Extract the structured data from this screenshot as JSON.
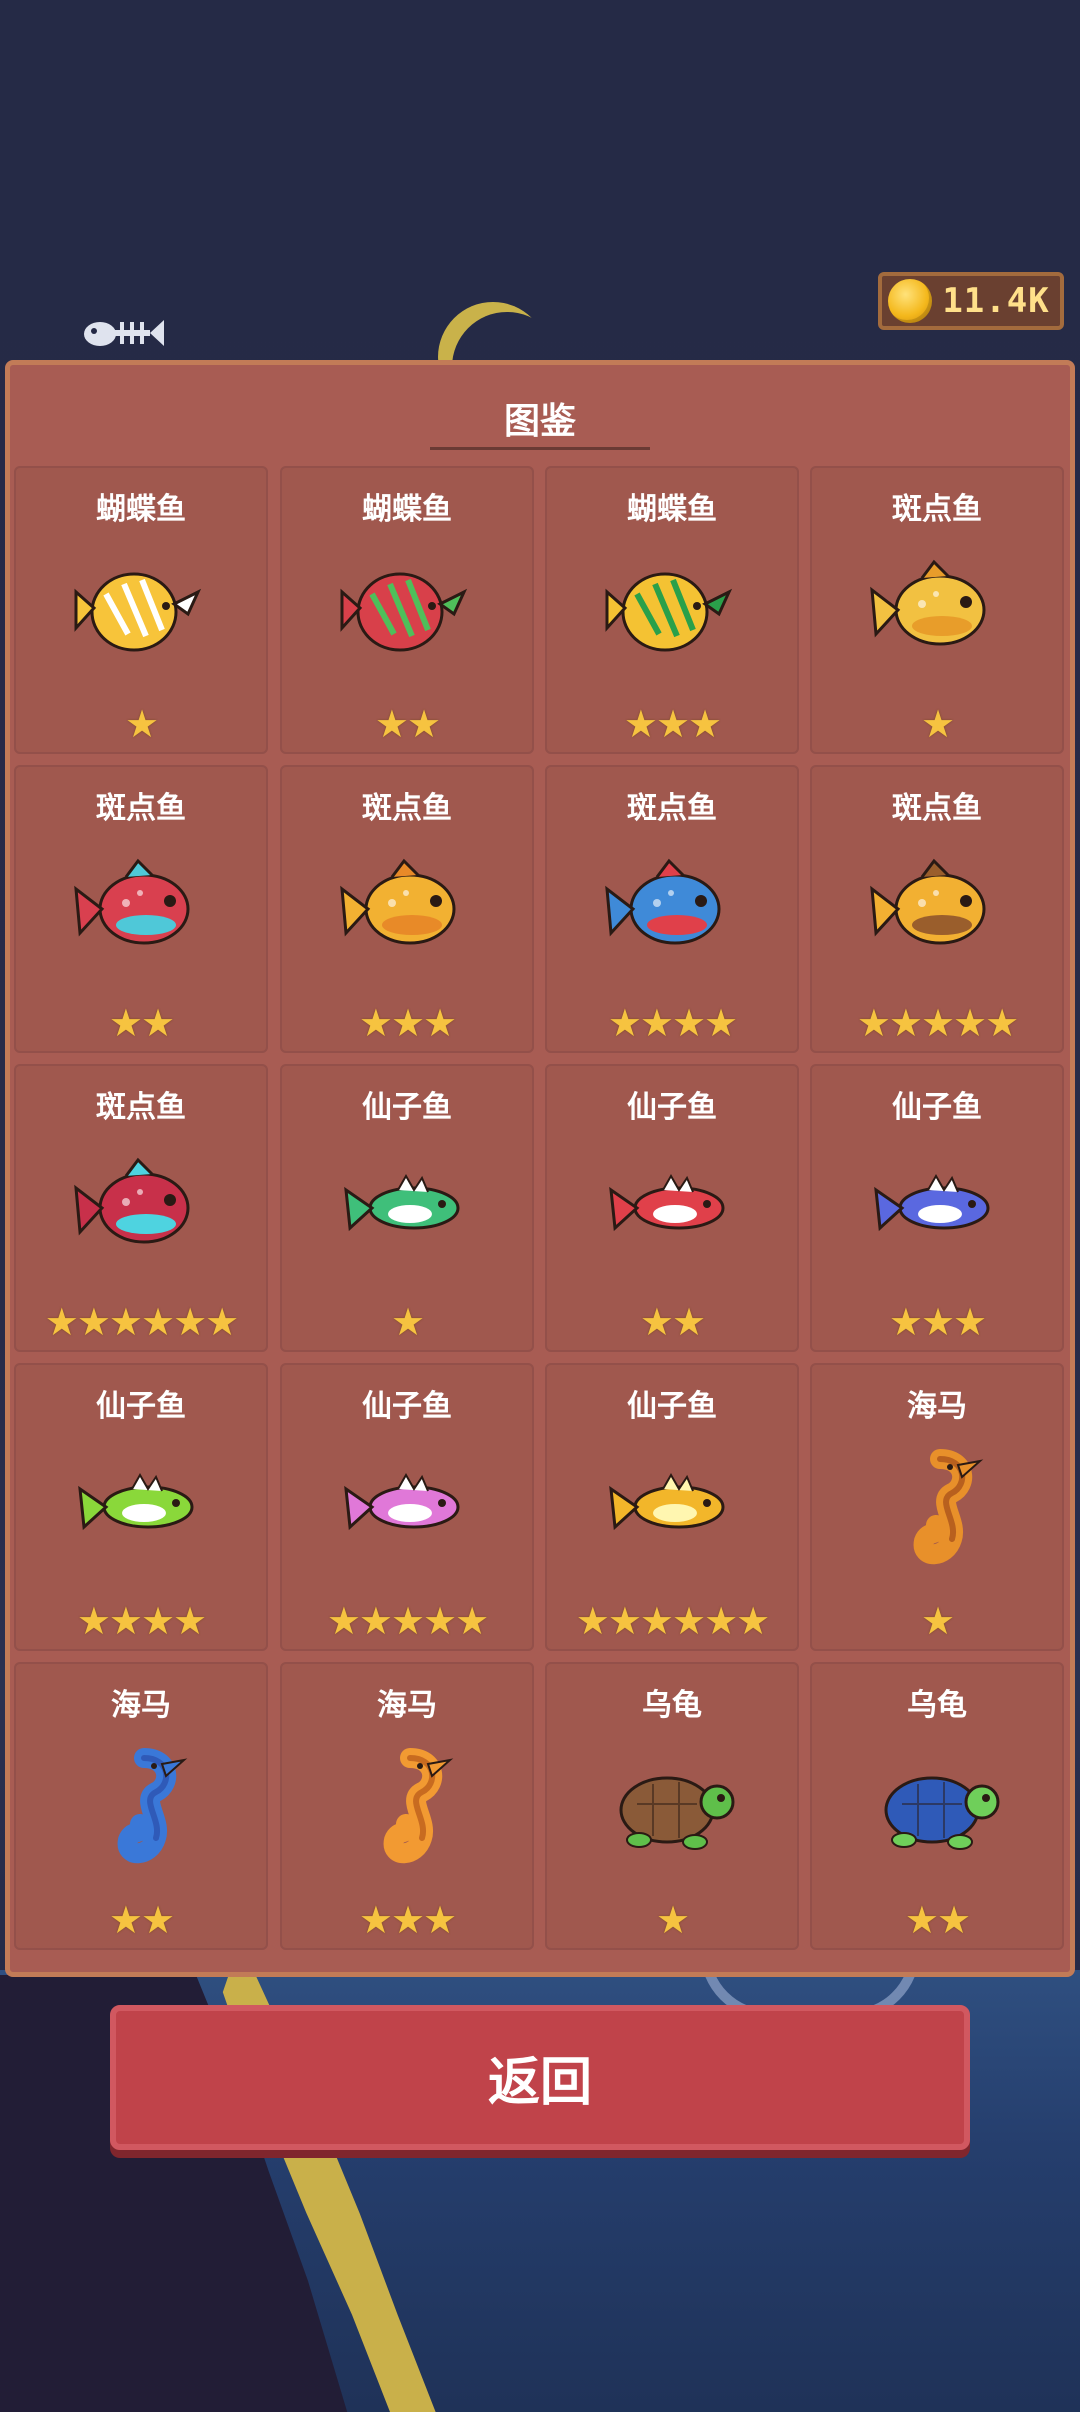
{
  "currency": {
    "coins": "11.4K"
  },
  "collection": {
    "title": "图鉴",
    "items": [
      {
        "name": "蝴蝶鱼",
        "stars": "★",
        "colors": [
          "#f7c43a",
          "#ffffff"
        ]
      },
      {
        "name": "蝴蝶鱼",
        "stars": "★★",
        "colors": [
          "#d8404a",
          "#4fbf5a"
        ]
      },
      {
        "name": "蝴蝶鱼",
        "stars": "★★★",
        "colors": [
          "#f4c233",
          "#2aa04a"
        ]
      },
      {
        "name": "斑点鱼",
        "stars": "★",
        "colors": [
          "#f2c141",
          "#e89d2a"
        ]
      },
      {
        "name": "斑点鱼",
        "stars": "★★",
        "colors": [
          "#d9404f",
          "#4fc8d8"
        ]
      },
      {
        "name": "斑点鱼",
        "stars": "★★★",
        "colors": [
          "#f2b132",
          "#e88a28"
        ]
      },
      {
        "name": "斑点鱼",
        "stars": "★★★★",
        "colors": [
          "#3f8ad8",
          "#e0404a"
        ]
      },
      {
        "name": "斑点鱼",
        "stars": "★★★★★",
        "colors": [
          "#f2b032",
          "#9a5e2c"
        ]
      },
      {
        "name": "斑点鱼",
        "stars": "★★★★★★",
        "colors": [
          "#c8304a",
          "#4ed3e0"
        ]
      },
      {
        "name": "仙子鱼",
        "stars": "★",
        "colors": [
          "#3fbf7a",
          "#ffffff"
        ]
      },
      {
        "name": "仙子鱼",
        "stars": "★★",
        "colors": [
          "#e0404a",
          "#ffffff"
        ]
      },
      {
        "name": "仙子鱼",
        "stars": "★★★",
        "colors": [
          "#5a68e0",
          "#ffffff"
        ]
      },
      {
        "name": "仙子鱼",
        "stars": "★★★★",
        "colors": [
          "#8ad83a",
          "#ffffff"
        ]
      },
      {
        "name": "仙子鱼",
        "stars": "★★★★★",
        "colors": [
          "#e078d8",
          "#ffffff"
        ]
      },
      {
        "name": "仙子鱼",
        "stars": "★★★★★★",
        "colors": [
          "#f2b62a",
          "#fff6b0"
        ]
      },
      {
        "name": "海马",
        "stars": "★",
        "colors": [
          "#e8902a",
          "#b8601e"
        ]
      },
      {
        "name": "海马",
        "stars": "★★",
        "colors": [
          "#3a78d8",
          "#2f5ab8"
        ]
      },
      {
        "name": "海马",
        "stars": "★★★",
        "colors": [
          "#f29a32",
          "#c86b20"
        ]
      },
      {
        "name": "乌龟",
        "stars": "★",
        "colors": [
          "#8a5a38",
          "#5fbf4a"
        ]
      },
      {
        "name": "乌龟",
        "stars": "★★",
        "colors": [
          "#2f5ab8",
          "#6fcf5a"
        ]
      }
    ]
  },
  "back_button": {
    "label": "返回"
  }
}
